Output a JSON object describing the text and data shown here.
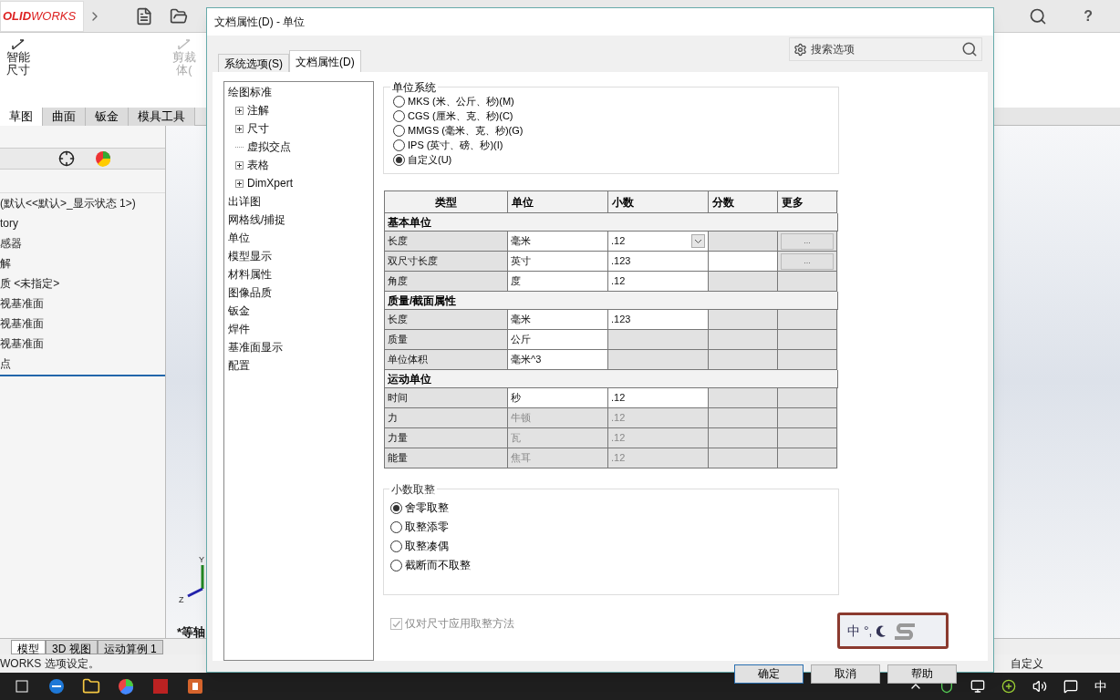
{
  "app": {
    "logo": "**OLID**WORKS",
    "help": "?",
    "ribbon_buttons": [
      {
        "label": "智能尺寸",
        "disabled": false
      },
      {
        "label": "剪裁体(",
        "disabled": true
      }
    ],
    "ribbon_tabs": [
      {
        "label": "草图",
        "selected": true
      },
      {
        "label": "曲面",
        "selected": false
      },
      {
        "label": "钣金",
        "selected": false
      },
      {
        "label": "模具工具",
        "selected": false
      }
    ],
    "tree": [
      "(默认<<默认>_显示状态 1>)",
      "tory",
      "感器",
      "解",
      "质 <未指定>",
      "视基准面",
      "视基准面",
      "视基准面",
      "点"
    ],
    "axes": [
      "Y",
      "Z"
    ],
    "view_label": "*等轴",
    "bottom_tabs": [
      {
        "label": "模型",
        "selected": true
      },
      {
        "label": "3D 视图",
        "selected": false
      },
      {
        "label": "运动算例 1",
        "selected": false
      }
    ],
    "status": "WORKS 选项设定。",
    "status_right": "自定义"
  },
  "dialog": {
    "title": "文档属性(D) - 单位",
    "tabs": [
      {
        "label": "系统选项(S)",
        "selected": false
      },
      {
        "label": "文档属性(D)",
        "selected": true
      }
    ],
    "search": {
      "placeholder": "搜索选项"
    },
    "tree": [
      {
        "label": "绘图标准",
        "children": [
          {
            "label": "注解",
            "expandable": true
          },
          {
            "label": "尺寸",
            "expandable": true
          },
          {
            "label": "虚拟交点",
            "expandable": false
          },
          {
            "label": "表格",
            "expandable": true
          },
          {
            "label": "DimXpert",
            "expandable": true
          }
        ]
      },
      {
        "label": "出详图"
      },
      {
        "label": "网格线/捕捉"
      },
      {
        "label": "单位"
      },
      {
        "label": "模型显示"
      },
      {
        "label": "材料属性"
      },
      {
        "label": "图像品质"
      },
      {
        "label": "钣金"
      },
      {
        "label": "焊件"
      },
      {
        "label": "基准面显示"
      },
      {
        "label": "配置"
      }
    ],
    "unit_system": {
      "title": "单位系统",
      "options": [
        {
          "label": "MKS (米、公斤、秒)(M)",
          "selected": false
        },
        {
          "label": "CGS (厘米、克、秒)(C)",
          "selected": false
        },
        {
          "label": "MMGS (毫米、克、秒)(G)",
          "selected": false
        },
        {
          "label": "IPS (英寸、磅、秒)(I)",
          "selected": false
        },
        {
          "label": "自定义(U)",
          "selected": true
        }
      ]
    },
    "table": {
      "columns": [
        "类型",
        "单位",
        "小数",
        "分数",
        "更多"
      ],
      "groups": [
        {
          "title": "基本单位",
          "rows": [
            {
              "type": "长度",
              "unit": "毫米",
              "unit_disabled": false,
              "decimals": ".12",
              "decimals_disabled": false,
              "dropdown": true,
              "fraction_disabled": true,
              "more": "..."
            },
            {
              "type": "双尺寸长度",
              "unit": "英寸",
              "unit_disabled": false,
              "decimals": ".123",
              "decimals_disabled": false,
              "fraction_disabled": false,
              "more": "..."
            },
            {
              "type": "角度",
              "unit": "度",
              "unit_disabled": false,
              "decimals": ".12",
              "decimals_disabled": false,
              "fraction_disabled": true
            }
          ]
        },
        {
          "title": "质量/截面属性",
          "rows": [
            {
              "type": "长度",
              "unit": "毫米",
              "unit_disabled": false,
              "decimals": ".123",
              "decimals_disabled": false,
              "fraction_disabled": true
            },
            {
              "type": "质量",
              "unit": "公斤",
              "unit_disabled": false,
              "decimals_disabled": true,
              "fraction_disabled": true
            },
            {
              "type": "单位体积",
              "unit": "毫米^3",
              "unit_disabled": false,
              "decimals_disabled": true,
              "fraction_disabled": true
            }
          ]
        },
        {
          "title": "运动单位",
          "rows": [
            {
              "type": "时间",
              "unit": "秒",
              "unit_disabled": false,
              "decimals": ".12",
              "decimals_disabled": false,
              "fraction_disabled": true
            },
            {
              "type": "力",
              "unit": "牛顿",
              "unit_disabled": true,
              "decimals": ".12",
              "decimals_disabled": true,
              "fraction_disabled": true
            },
            {
              "type": "力量",
              "unit": "瓦",
              "unit_disabled": true,
              "decimals": ".12",
              "decimals_disabled": true,
              "fraction_disabled": true
            },
            {
              "type": "能量",
              "unit": "焦耳",
              "unit_disabled": true,
              "decimals": ".12",
              "decimals_disabled": true,
              "fraction_disabled": true
            }
          ]
        }
      ]
    },
    "rounding": {
      "title": "小数取整",
      "options": [
        {
          "label": "舍零取整",
          "selected": true
        },
        {
          "label": "取整添零",
          "selected": false
        },
        {
          "label": "取整凑偶",
          "selected": false
        },
        {
          "label": "截断而不取整",
          "selected": false
        }
      ]
    },
    "dims_only": {
      "label": "仅对尺寸应用取整方法",
      "checked": true,
      "disabled": true
    },
    "buttons": [
      {
        "label": "确定",
        "default": true
      },
      {
        "label": "取消",
        "default": false
      },
      {
        "label": "帮助",
        "default": false
      }
    ]
  },
  "ime": {
    "label": "中",
    "marks": "°,"
  },
  "taskbar": {
    "language": "中"
  }
}
